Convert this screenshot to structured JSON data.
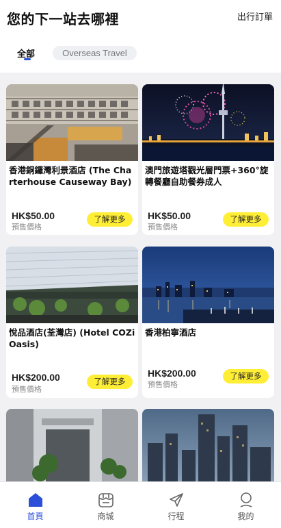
{
  "header": {
    "title": "您的下一站去哪裡",
    "orders_link": "出行訂單"
  },
  "tabs": [
    {
      "label": "全部",
      "active": true
    },
    {
      "label": "Overseas Travel",
      "active": false
    }
  ],
  "products": [
    {
      "title": "香港銅鑼灣利景酒店 (The Charterhouse Causeway Bay)",
      "price": "HK$50.00",
      "price_note": "預售價格",
      "action_label": "了解更多",
      "image_icon": "hotel-building-photo"
    },
    {
      "title": "澳門旅遊塔觀光層門票+360°旋轉餐廳自助餐券成人",
      "price": "HK$50.00",
      "price_note": "預售價格",
      "action_label": "了解更多",
      "image_icon": "macau-tower-fireworks-photo"
    },
    {
      "title": "悅品酒店(荃灣店) (Hotel COZi Oasis)",
      "price": "HK$200.00",
      "price_note": "預售價格",
      "action_label": "了解更多",
      "image_icon": "hotel-tower-photo"
    },
    {
      "title": "香港柏寧酒店",
      "price": "HK$200.00",
      "price_note": "預售價格",
      "action_label": "了解更多",
      "image_icon": "harbour-night-photo"
    },
    {
      "title": "",
      "price": "",
      "price_note": "",
      "action_label": "",
      "image_icon": "hotel-entrance-photo"
    },
    {
      "title": "",
      "price": "",
      "price_note": "",
      "action_label": "",
      "image_icon": "city-skyline-photo"
    }
  ],
  "bottom_nav": [
    {
      "label": "首頁",
      "icon": "home-icon",
      "active": true
    },
    {
      "label": "商城",
      "icon": "shop-icon",
      "active": false
    },
    {
      "label": "行程",
      "icon": "send-icon",
      "active": false
    },
    {
      "label": "我的",
      "icon": "user-icon",
      "active": false
    }
  ],
  "colors": {
    "accent": "#2b4fd8",
    "button": "#ffee36",
    "background": "#f1f1f3"
  }
}
